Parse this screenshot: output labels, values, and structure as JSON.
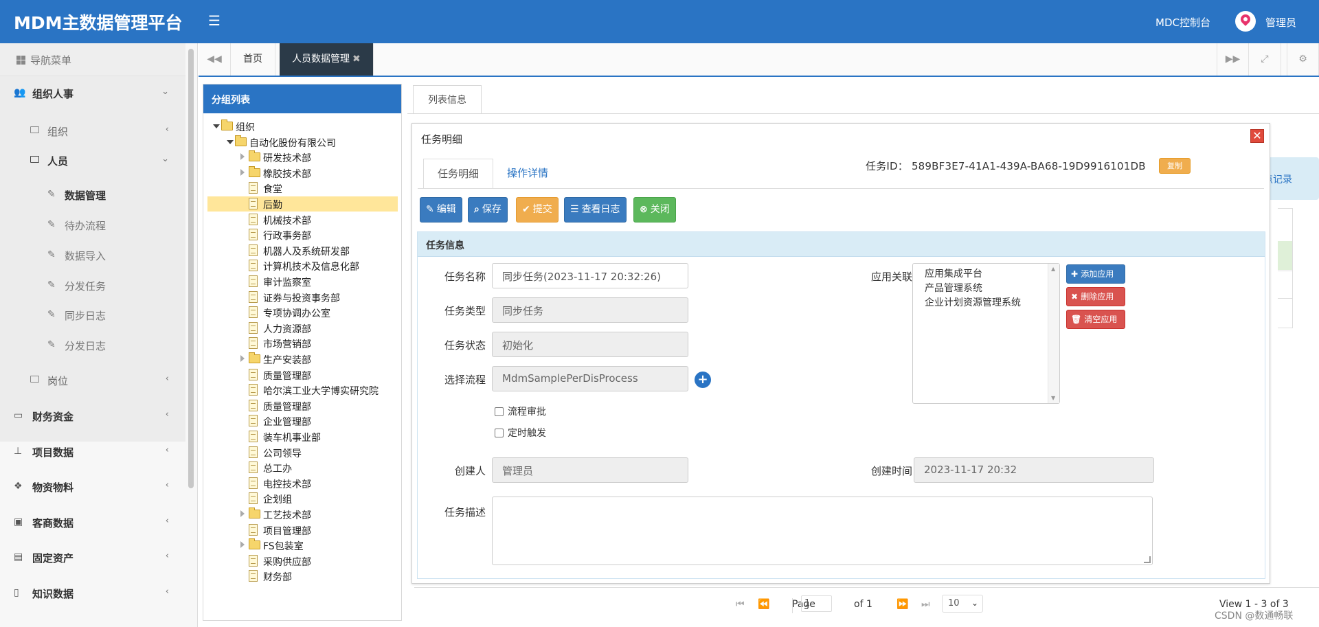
{
  "header": {
    "brand": "MDM主数据管理平台",
    "menu_icon": "hamburger-icon",
    "console": "MDC控制台",
    "user": "管理员"
  },
  "sidebar": {
    "nav_title": "导航菜单",
    "sections": [
      {
        "label": "组织人事"
      },
      {
        "label": "组织"
      },
      {
        "label": "人员"
      },
      {
        "label": "数据管理"
      },
      {
        "label": "待办流程"
      },
      {
        "label": "数据导入"
      },
      {
        "label": "分发任务"
      },
      {
        "label": "同步日志"
      },
      {
        "label": "分发日志"
      },
      {
        "label": "岗位"
      },
      {
        "label": "财务资金"
      },
      {
        "label": "项目数据"
      },
      {
        "label": "物资物料"
      },
      {
        "label": "客商数据"
      },
      {
        "label": "固定资产"
      },
      {
        "label": "知识数据"
      }
    ]
  },
  "tabs": {
    "home": "首页",
    "active": "人员数据管理",
    "close": "✖"
  },
  "tree": {
    "title": "分组列表",
    "nodes": [
      "组织",
      "自动化股份有限公司",
      "研发技术部",
      "橡胶技术部",
      "食堂",
      "后勤",
      "机械技术部",
      "行政事务部",
      "机器人及系统研发部",
      "计算机技术及信息化部",
      "审计监察室",
      "证券与投资事务部",
      "专项协调办公室",
      "人力资源部",
      "市场营销部",
      "生产安装部",
      "质量管理部",
      "哈尔滨工业大学博实研究院",
      "质量管理部",
      "企业管理部",
      "装车机事业部",
      "公司领导",
      "总工办",
      "电控技术部",
      "企划组",
      "工艺技术部",
      "项目管理部",
      "FS包装室",
      "采购供应部",
      "财务部"
    ]
  },
  "main": {
    "list_tab": "列表信息",
    "bg_record": "点记录"
  },
  "modal": {
    "title": "任务明细",
    "tab_detail": "任务明细",
    "tab_ops": "操作详情",
    "task_id": "任务ID：  589BF3E7-41A1-439A-BA68-19D9916101DB",
    "copy": "复制",
    "buttons": {
      "edit": "编辑",
      "save": "保存",
      "submit": "提交",
      "log": "查看日志",
      "close": "关闭"
    },
    "section_title": "任务信息",
    "fields": {
      "name_label": "任务名称",
      "name_value": "同步任务(2023-11-17 20:32:26)",
      "type_label": "任务类型",
      "type_value": "同步任务",
      "status_label": "任务状态",
      "status_value": "初始化",
      "flow_label": "选择流程",
      "flow_value": "MdmSamplePerDisProcess",
      "check_approval": "流程审批",
      "check_timer": "定时触发",
      "creator_label": "创建人",
      "creator_value": "管理员",
      "created_label": "创建时间",
      "created_value": "2023-11-17 20:32",
      "desc_label": "任务描述",
      "app_label": "应用关联",
      "apps": [
        "应用集成平台",
        "产品管理系统",
        "企业计划资源管理系统"
      ],
      "add_app": "添加应用",
      "del_app": "删除应用",
      "clear_app": "清空应用"
    }
  },
  "pager": {
    "page_label": "Page",
    "page_value": "1",
    "of_label": "of 1",
    "size": "10",
    "view": "View 1 - 3 of 3"
  },
  "watermark": "CSDN @数通畅联"
}
